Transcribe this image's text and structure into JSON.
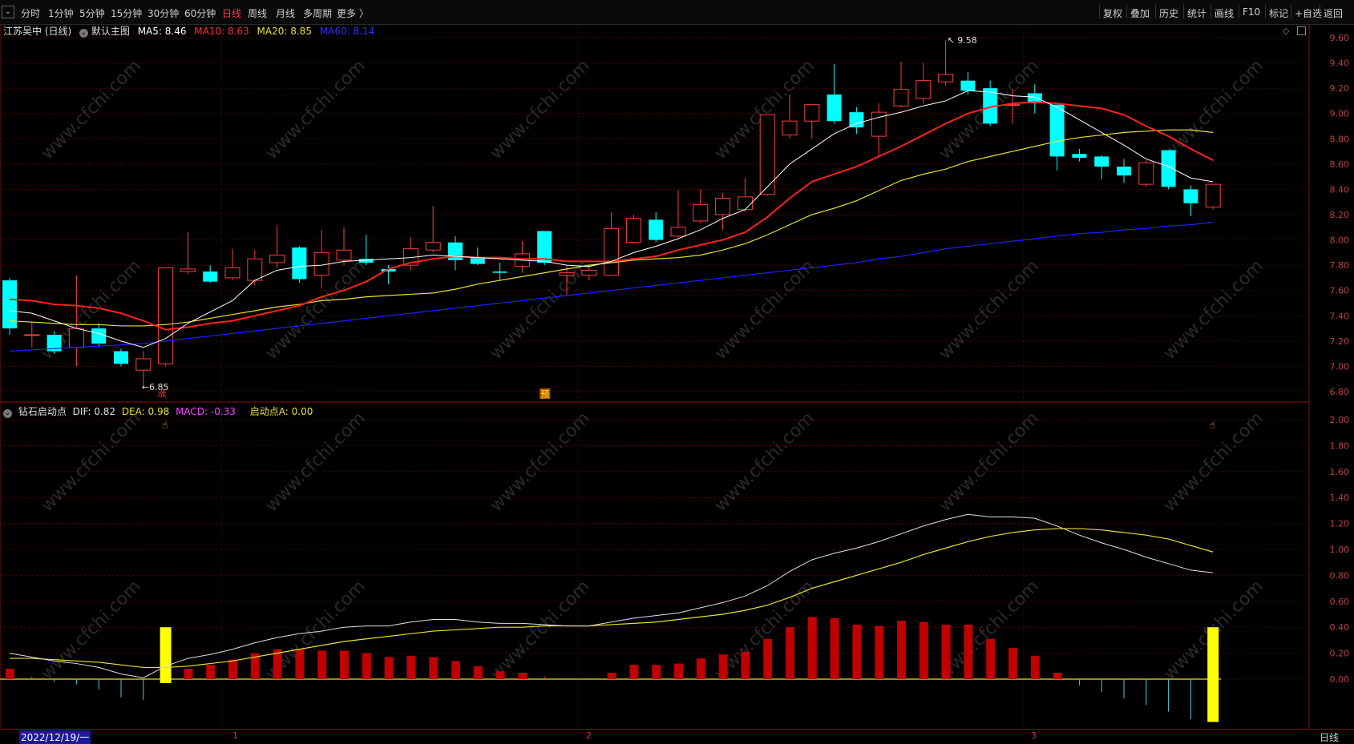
{
  "toolbar": {
    "periods": [
      "分时",
      "1分钟",
      "5分钟",
      "15分钟",
      "30分钟",
      "60分钟",
      "日线",
      "周线",
      "月线",
      "多周期",
      "更多 〉"
    ],
    "active_period": "日线",
    "tools": [
      "复权",
      "叠加",
      "历史",
      "统计",
      "画线",
      "F10",
      "标记",
      "+自选",
      "返回"
    ]
  },
  "main_chart": {
    "title": "江苏吴中 (日线)",
    "template": "默认主图",
    "ma5_label": "MA5: 8.46",
    "ma10_label": "MA10: 8.63",
    "ma20_label": "MA20: 8.85",
    "ma60_label": "MA60: 8.14",
    "high_mark": "9.58",
    "low_mark": "6.85",
    "badge_zhang": "涨",
    "badge_yu": "预"
  },
  "indicator": {
    "name": "钻石启动点",
    "dif_label": "DIF: 0.82",
    "dea_label": "DEA: 0.98",
    "macd_label": "MACD: -0.33",
    "start_label": "启动点A: 0.00"
  },
  "bottom": {
    "date": "2022/12/19/一",
    "months": [
      "1",
      "2",
      "3"
    ],
    "period_label": "日线"
  },
  "colors": {
    "up": "#ff3c3c",
    "down": "#00ffff",
    "ma5": "#ffffff",
    "ma10": "#ff2020",
    "ma20": "#e8e030",
    "ma60": "#2020ff",
    "grid": "#5a0000"
  },
  "chart_data": {
    "type": "candlestick",
    "price_axis_ticks": [
      "9.60",
      "9.40",
      "9.20",
      "9.00",
      "8.80",
      "8.60",
      "8.40",
      "8.20",
      "8.00",
      "7.80",
      "7.60",
      "7.40",
      "7.20",
      "7.00",
      "6.80"
    ],
    "indicator_axis_ticks": [
      "2.00",
      "1.80",
      "1.60",
      "1.40",
      "1.20",
      "1.00",
      "0.80",
      "0.60",
      "0.40",
      "0.20",
      "0.00"
    ],
    "candles": [
      {
        "o": 7.68,
        "c": 7.3,
        "h": 7.7,
        "l": 7.25
      },
      {
        "o": 7.25,
        "c": 7.25,
        "h": 7.35,
        "l": 7.15
      },
      {
        "o": 7.25,
        "c": 7.12,
        "h": 7.28,
        "l": 7.1
      },
      {
        "o": 7.15,
        "c": 7.3,
        "h": 7.72,
        "l": 7.0
      },
      {
        "o": 7.3,
        "c": 7.18,
        "h": 7.34,
        "l": 7.15
      },
      {
        "o": 7.12,
        "c": 7.02,
        "h": 7.14,
        "l": 7.0
      },
      {
        "o": 6.97,
        "c": 7.06,
        "h": 7.12,
        "l": 6.85
      },
      {
        "o": 7.02,
        "c": 7.78,
        "h": 7.78,
        "l": 7.0
      },
      {
        "o": 7.75,
        "c": 7.77,
        "h": 8.06,
        "l": 7.73
      },
      {
        "o": 7.75,
        "c": 7.67,
        "h": 7.8,
        "l": 7.66
      },
      {
        "o": 7.7,
        "c": 7.78,
        "h": 7.93,
        "l": 7.68
      },
      {
        "o": 7.68,
        "c": 7.85,
        "h": 7.92,
        "l": 7.64
      },
      {
        "o": 7.82,
        "c": 7.88,
        "h": 8.12,
        "l": 7.78
      },
      {
        "o": 7.94,
        "c": 7.69,
        "h": 7.95,
        "l": 7.66
      },
      {
        "o": 7.72,
        "c": 7.9,
        "h": 8.08,
        "l": 7.62
      },
      {
        "o": 7.84,
        "c": 7.92,
        "h": 8.1,
        "l": 7.8
      },
      {
        "o": 7.85,
        "c": 7.82,
        "h": 8.04,
        "l": 7.8
      },
      {
        "o": 7.77,
        "c": 7.75,
        "h": 7.8,
        "l": 7.65
      },
      {
        "o": 7.8,
        "c": 7.93,
        "h": 8.02,
        "l": 7.76
      },
      {
        "o": 7.92,
        "c": 7.98,
        "h": 8.27,
        "l": 7.9
      },
      {
        "o": 7.98,
        "c": 7.84,
        "h": 8.03,
        "l": 7.76
      },
      {
        "o": 7.86,
        "c": 7.81,
        "h": 7.94,
        "l": 7.8
      },
      {
        "o": 7.75,
        "c": 7.74,
        "h": 7.82,
        "l": 7.68
      },
      {
        "o": 7.79,
        "c": 7.89,
        "h": 7.99,
        "l": 7.74
      },
      {
        "o": 8.07,
        "c": 7.82,
        "h": 8.07,
        "l": 7.8
      },
      {
        "o": 7.72,
        "c": 7.74,
        "h": 7.8,
        "l": 7.56
      },
      {
        "o": 7.72,
        "c": 7.76,
        "h": 7.8,
        "l": 7.68
      },
      {
        "o": 7.72,
        "c": 8.09,
        "h": 8.22,
        "l": 7.72
      },
      {
        "o": 7.98,
        "c": 8.17,
        "h": 8.2,
        "l": 7.97
      },
      {
        "o": 8.16,
        "c": 8.0,
        "h": 8.22,
        "l": 7.98
      },
      {
        "o": 8.03,
        "c": 8.1,
        "h": 8.39,
        "l": 8.02
      },
      {
        "o": 8.15,
        "c": 8.28,
        "h": 8.4,
        "l": 8.13
      },
      {
        "o": 8.2,
        "c": 8.33,
        "h": 8.37,
        "l": 8.08
      },
      {
        "o": 8.24,
        "c": 8.34,
        "h": 8.49,
        "l": 8.22
      },
      {
        "o": 8.36,
        "c": 8.99,
        "h": 8.99,
        "l": 8.35
      },
      {
        "o": 8.83,
        "c": 8.94,
        "h": 9.15,
        "l": 8.8
      },
      {
        "o": 8.94,
        "c": 9.07,
        "h": 9.07,
        "l": 8.8
      },
      {
        "o": 9.15,
        "c": 8.94,
        "h": 9.39,
        "l": 8.92
      },
      {
        "o": 9.01,
        "c": 8.89,
        "h": 9.05,
        "l": 8.84
      },
      {
        "o": 8.82,
        "c": 9.01,
        "h": 9.08,
        "l": 8.66
      },
      {
        "o": 9.06,
        "c": 9.19,
        "h": 9.41,
        "l": 9.05
      },
      {
        "o": 9.12,
        "c": 9.26,
        "h": 9.4,
        "l": 9.08
      },
      {
        "o": 9.25,
        "c": 9.31,
        "h": 9.58,
        "l": 9.22
      },
      {
        "o": 9.26,
        "c": 9.18,
        "h": 9.33,
        "l": 9.15
      },
      {
        "o": 9.2,
        "c": 8.92,
        "h": 9.26,
        "l": 8.9
      },
      {
        "o": 9.07,
        "c": 9.07,
        "h": 9.19,
        "l": 8.92
      },
      {
        "o": 9.16,
        "c": 9.08,
        "h": 9.23,
        "l": 9.0
      },
      {
        "o": 9.07,
        "c": 8.66,
        "h": 9.07,
        "l": 8.55
      },
      {
        "o": 8.68,
        "c": 8.65,
        "h": 8.72,
        "l": 8.62
      },
      {
        "o": 8.66,
        "c": 8.58,
        "h": 8.67,
        "l": 8.48
      },
      {
        "o": 8.58,
        "c": 8.51,
        "h": 8.64,
        "l": 8.45
      },
      {
        "o": 8.44,
        "c": 8.61,
        "h": 8.63,
        "l": 8.42
      },
      {
        "o": 8.71,
        "c": 8.42,
        "h": 8.71,
        "l": 8.4
      },
      {
        "o": 8.4,
        "c": 8.29,
        "h": 8.43,
        "l": 8.19
      },
      {
        "o": 8.26,
        "c": 8.44,
        "h": 8.44,
        "l": 8.24
      }
    ],
    "ma5": [
      7.44,
      7.42,
      7.36,
      7.3,
      7.26,
      7.2,
      7.15,
      7.22,
      7.34,
      7.43,
      7.52,
      7.68,
      7.76,
      7.79,
      7.8,
      7.83,
      7.84,
      7.85,
      7.86,
      7.88,
      7.87,
      7.86,
      7.85,
      7.84,
      7.83,
      7.8,
      7.79,
      7.83,
      7.9,
      7.95,
      8.01,
      8.08,
      8.17,
      8.24,
      8.42,
      8.6,
      8.72,
      8.84,
      8.92,
      8.97,
      9.01,
      9.06,
      9.1,
      9.18,
      9.17,
      9.14,
      9.13,
      9.05,
      8.95,
      8.85,
      8.75,
      8.64,
      8.58,
      8.49,
      8.46
    ],
    "ma10": [
      7.53,
      7.52,
      7.49,
      7.48,
      7.46,
      7.42,
      7.36,
      7.29,
      7.31,
      7.34,
      7.36,
      7.4,
      7.44,
      7.48,
      7.55,
      7.6,
      7.67,
      7.77,
      7.82,
      7.85,
      7.87,
      7.86,
      7.86,
      7.85,
      7.85,
      7.83,
      7.83,
      7.83,
      7.85,
      7.87,
      7.92,
      7.96,
      8.0,
      8.06,
      8.18,
      8.33,
      8.46,
      8.52,
      8.58,
      8.66,
      8.74,
      8.83,
      8.92,
      9.0,
      9.05,
      9.08,
      9.09,
      9.08,
      9.06,
      9.04,
      8.99,
      8.9,
      8.82,
      8.72,
      8.63
    ],
    "ma20": [
      7.36,
      7.35,
      7.34,
      7.33,
      7.33,
      7.32,
      7.32,
      7.33,
      7.35,
      7.38,
      7.41,
      7.44,
      7.47,
      7.49,
      7.52,
      7.53,
      7.55,
      7.56,
      7.57,
      7.58,
      7.61,
      7.65,
      7.68,
      7.71,
      7.74,
      7.77,
      7.8,
      7.82,
      7.84,
      7.85,
      7.86,
      7.88,
      7.92,
      7.97,
      8.04,
      8.12,
      8.2,
      8.25,
      8.31,
      8.39,
      8.47,
      8.52,
      8.56,
      8.62,
      8.66,
      8.7,
      8.74,
      8.78,
      8.81,
      8.83,
      8.85,
      8.86,
      8.87,
      8.87,
      8.85
    ],
    "ma60": [
      7.12,
      7.13,
      7.14,
      7.15,
      7.16,
      7.17,
      7.18,
      7.2,
      7.22,
      7.24,
      7.26,
      7.28,
      7.3,
      7.32,
      7.34,
      7.36,
      7.38,
      7.4,
      7.42,
      7.44,
      7.46,
      7.48,
      7.5,
      7.52,
      7.54,
      7.56,
      7.58,
      7.6,
      7.62,
      7.64,
      7.66,
      7.68,
      7.7,
      7.72,
      7.74,
      7.76,
      7.78,
      7.8,
      7.82,
      7.85,
      7.87,
      7.9,
      7.93,
      7.95,
      7.97,
      7.99,
      8.01,
      8.03,
      8.05,
      8.06,
      8.08,
      8.09,
      8.11,
      8.12,
      8.14
    ],
    "dif": [
      0.2,
      0.17,
      0.14,
      0.12,
      0.09,
      0.04,
      0.01,
      0.1,
      0.16,
      0.19,
      0.23,
      0.28,
      0.32,
      0.35,
      0.37,
      0.4,
      0.41,
      0.41,
      0.44,
      0.46,
      0.46,
      0.44,
      0.43,
      0.43,
      0.42,
      0.41,
      0.41,
      0.44,
      0.47,
      0.49,
      0.51,
      0.55,
      0.59,
      0.64,
      0.72,
      0.83,
      0.92,
      0.97,
      1.01,
      1.06,
      1.12,
      1.18,
      1.23,
      1.27,
      1.25,
      1.25,
      1.24,
      1.18,
      1.11,
      1.05,
      1.0,
      0.94,
      0.89,
      0.84,
      0.82
    ],
    "dea": [
      0.16,
      0.16,
      0.15,
      0.14,
      0.13,
      0.11,
      0.09,
      0.09,
      0.1,
      0.12,
      0.14,
      0.17,
      0.2,
      0.23,
      0.26,
      0.29,
      0.31,
      0.33,
      0.35,
      0.37,
      0.38,
      0.39,
      0.4,
      0.4,
      0.41,
      0.41,
      0.41,
      0.42,
      0.43,
      0.44,
      0.46,
      0.48,
      0.5,
      0.53,
      0.57,
      0.63,
      0.7,
      0.75,
      0.8,
      0.85,
      0.9,
      0.96,
      1.01,
      1.06,
      1.1,
      1.13,
      1.15,
      1.16,
      1.16,
      1.15,
      1.13,
      1.11,
      1.08,
      1.03,
      0.98
    ],
    "macd": [
      0.08,
      0.02,
      -0.02,
      -0.04,
      -0.08,
      -0.14,
      -0.16,
      0.02,
      0.08,
      0.11,
      0.15,
      0.2,
      0.23,
      0.23,
      0.22,
      0.22,
      0.2,
      0.17,
      0.18,
      0.17,
      0.14,
      0.1,
      0.06,
      0.05,
      0.02,
      0.0,
      0.0,
      0.05,
      0.11,
      0.11,
      0.12,
      0.16,
      0.19,
      0.21,
      0.31,
      0.4,
      0.48,
      0.47,
      0.42,
      0.41,
      0.45,
      0.44,
      0.42,
      0.42,
      0.31,
      0.24,
      0.18,
      0.05,
      -0.05,
      -0.1,
      -0.15,
      -0.2,
      -0.25,
      -0.31,
      -0.33
    ],
    "start_signals": [
      7,
      54
    ]
  }
}
